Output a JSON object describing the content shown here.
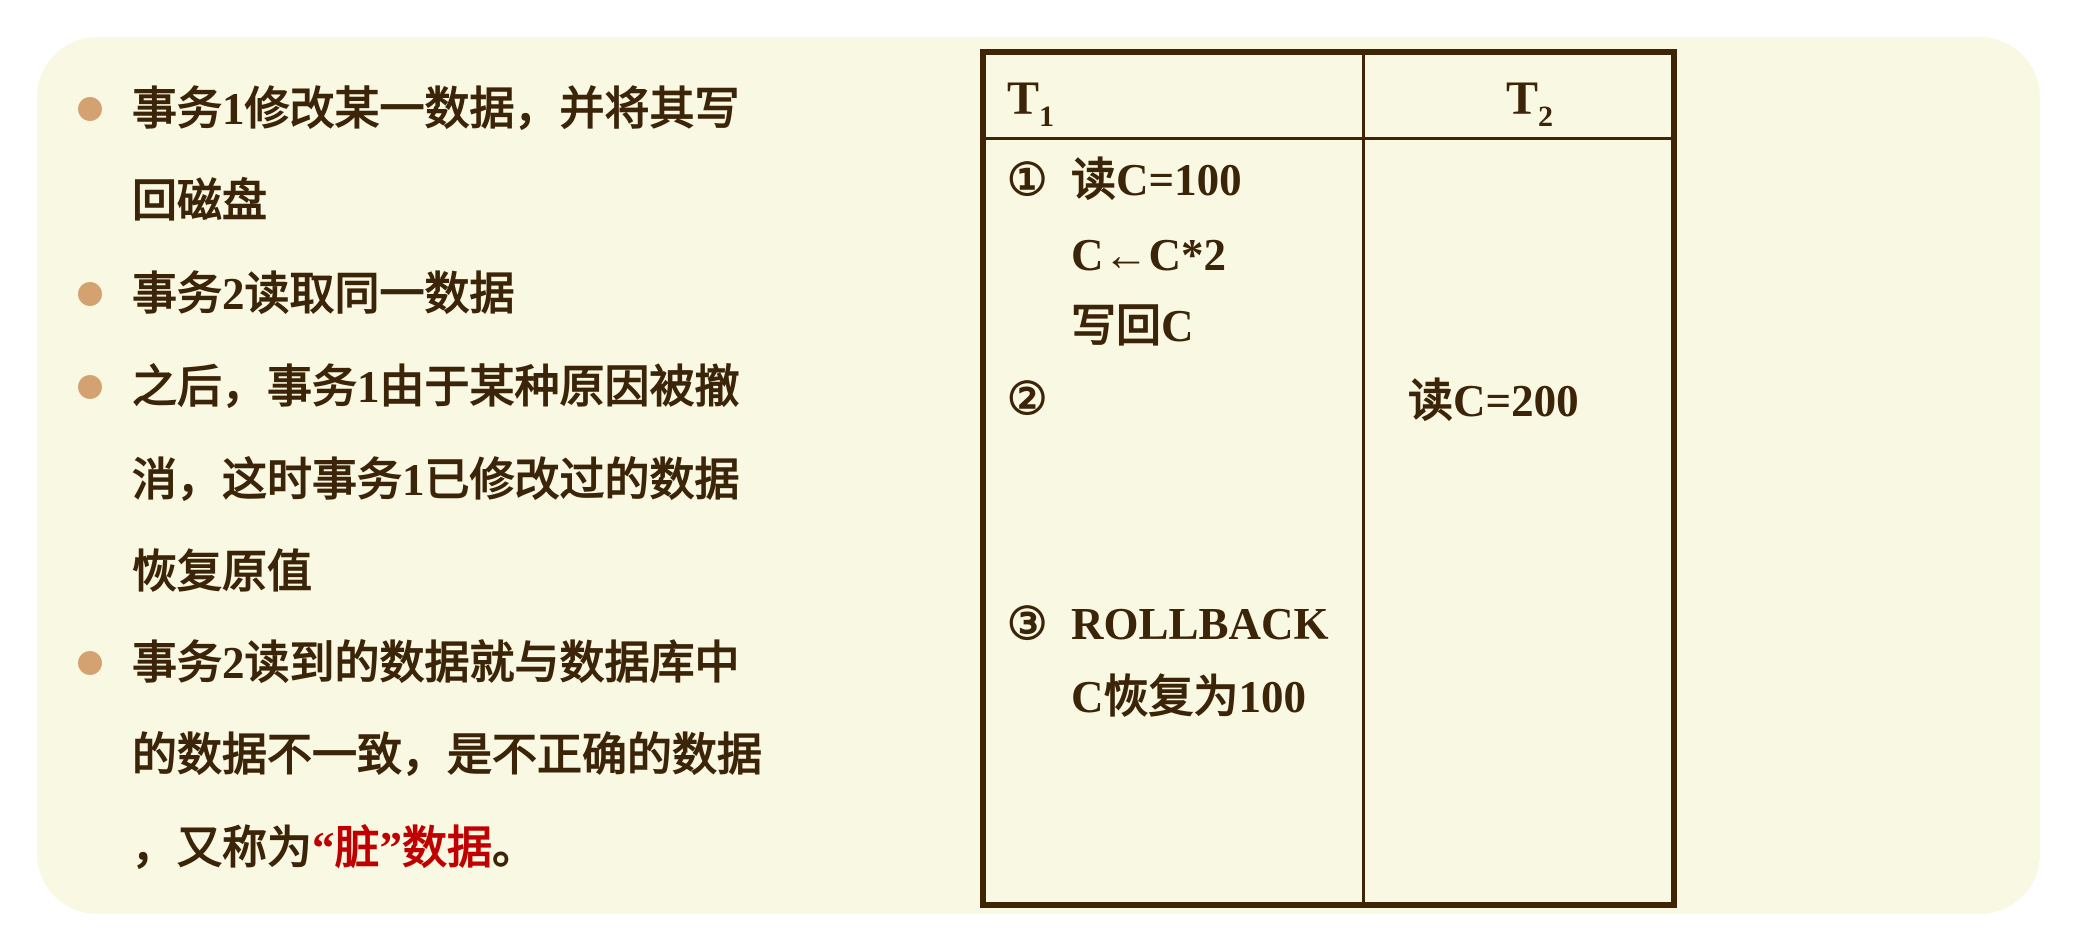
{
  "bullets": [
    {
      "lines": [
        "事务1修改某一数据，并将其写",
        "回磁盘"
      ]
    },
    {
      "lines": [
        "事务2读取同一数据"
      ]
    },
    {
      "lines": [
        "之后，事务1由于某种原因被撤",
        "消，这时事务1已修改过的数据",
        "恢复原值"
      ]
    },
    {
      "lines": [
        "事务2读到的数据就与数据库中",
        "的数据不一致，是不正确的数据"
      ],
      "last_line": {
        "prefix": "，又称为",
        "highlight": "“脏”数据",
        "suffix": "。"
      }
    }
  ],
  "table": {
    "headers": [
      {
        "main": "T",
        "sub": "1"
      },
      {
        "main": "T",
        "sub": "2"
      }
    ],
    "t1": [
      {
        "marker": "①",
        "text": "读C=100"
      },
      {
        "marker": "",
        "text": "C←C*2"
      },
      {
        "marker": "",
        "text": "写回C"
      },
      {
        "marker": "②",
        "text": ""
      },
      {
        "marker": "③",
        "text": "ROLLBACK"
      },
      {
        "marker": "",
        "text": "C恢复为100"
      }
    ],
    "t2": [
      {
        "text": "读C=200"
      }
    ]
  },
  "colors": {
    "text": "#3b2408",
    "highlight": "#c00000",
    "bullet": "#d4a170",
    "panel": "#f9f8e3",
    "border": "#3f2406"
  }
}
